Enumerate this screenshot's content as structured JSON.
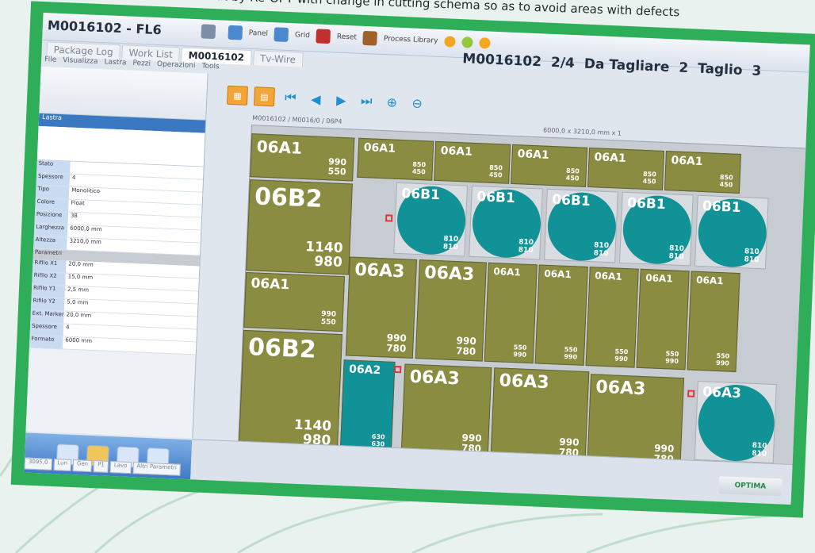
{
  "caption": "out by Re-OPT with change in cutting schema so as to avoid areas with defects",
  "app": {
    "title": "M0016102 - FL6"
  },
  "toolbar": {
    "icons": [
      {
        "name": "save-icon",
        "label": "",
        "color": "#7d8ea6"
      },
      {
        "name": "layout-icon",
        "label": "Panel",
        "color": "#4b88cf"
      },
      {
        "name": "grid-icon",
        "label": "Grid",
        "color": "#4b88cf"
      },
      {
        "name": "reset-icon",
        "label": "Reset",
        "color": "#c03030"
      },
      {
        "name": "person-icon",
        "label": "Process Library",
        "color": "#a0602a"
      }
    ],
    "lights": [
      "#f5a623",
      "#92c93a",
      "#f5a623"
    ]
  },
  "order_status": {
    "order": "M0016102",
    "sheet": "2/4",
    "to_cut_label": "Da Tagliare",
    "to_cut": "2",
    "cut_label": "Taglio",
    "cut": "3"
  },
  "tabs": [
    {
      "label": "Package Log",
      "active": false
    },
    {
      "label": "Work List",
      "active": false
    },
    {
      "label": "M0016102",
      "active": true
    },
    {
      "label": "Tv-Wire",
      "active": false
    }
  ],
  "menu": [
    "File",
    "Visualizza",
    "Lastra",
    "Pezzi",
    "Operazioni",
    "Tools"
  ],
  "left_panel": {
    "header": "Lastra",
    "props": [
      {
        "key": "Stato",
        "value": ""
      },
      {
        "key": "Spessore",
        "value": "4"
      },
      {
        "key": "Tipo",
        "value": "Monolitico"
      },
      {
        "key": "Colore",
        "value": "Float"
      },
      {
        "key": "Posizione",
        "value": "38"
      },
      {
        "key": "Larghezza",
        "value": "6000,0 mm"
      },
      {
        "key": "Altezza",
        "value": "3210,0 mm"
      }
    ],
    "section": "Parametri",
    "props2": [
      {
        "key": "Rifilo X1",
        "value": "20,0 mm"
      },
      {
        "key": "Rifilo X2",
        "value": "15,0 mm"
      },
      {
        "key": "Rifilo Y1",
        "value": "2,5 mm"
      },
      {
        "key": "Rifilo Y2",
        "value": "5,0 mm"
      },
      {
        "key": "Ext. Marker",
        "value": "20,0 mm"
      },
      {
        "key": "Spessore",
        "value": "4"
      },
      {
        "key": "Formato",
        "value": "6000 mm"
      }
    ]
  },
  "nav": {
    "buttons": [
      "first-icon",
      "prev-icon",
      "next-icon",
      "last-icon",
      "zoom-in-icon",
      "zoom-out-icon"
    ]
  },
  "canvas": {
    "header_left": "M0016102 / M0016/0 / 06P4",
    "header_mid": "6000,0 x 3210,0 mm x 1"
  },
  "pieces": [
    {
      "name": "06A1",
      "w": "990",
      "h": "550"
    },
    {
      "name": "06A1",
      "w": "850",
      "h": "450"
    },
    {
      "name": "06A1",
      "w": "850",
      "h": "450"
    },
    {
      "name": "06A1",
      "w": "850",
      "h": "450"
    },
    {
      "name": "06A1",
      "w": "850",
      "h": "450"
    },
    {
      "name": "06A1",
      "w": "850",
      "h": "450"
    },
    {
      "name": "06B2",
      "w": "1140",
      "h": "980"
    },
    {
      "name": "06B1",
      "w": "810",
      "h": "810"
    },
    {
      "name": "06B1",
      "w": "810",
      "h": "810"
    },
    {
      "name": "06B1",
      "w": "810",
      "h": "810"
    },
    {
      "name": "06B1",
      "w": "810",
      "h": "810"
    },
    {
      "name": "06B1",
      "w": "810",
      "h": "810"
    },
    {
      "name": "06A1",
      "w": "990",
      "h": "550"
    },
    {
      "name": "06A3",
      "w": "990",
      "h": "780"
    },
    {
      "name": "06A3",
      "w": "990",
      "h": "780"
    },
    {
      "name": "06A1",
      "w": "550",
      "h": "990"
    },
    {
      "name": "06A1",
      "w": "550",
      "h": "990"
    },
    {
      "name": "06A1",
      "w": "550",
      "h": "990"
    },
    {
      "name": "06A1",
      "w": "550",
      "h": "990"
    },
    {
      "name": "06A1",
      "w": "550",
      "h": "990"
    },
    {
      "name": "06B2",
      "w": "1140",
      "h": "980"
    },
    {
      "name": "06A2",
      "w": "630",
      "h": "630"
    },
    {
      "name": "06A3",
      "w": "990",
      "h": "780"
    },
    {
      "name": "06A3",
      "w": "990",
      "h": "780"
    },
    {
      "name": "06A3",
      "w": "990",
      "h": "780"
    },
    {
      "name": "06A3",
      "w": "810",
      "h": "810"
    }
  ],
  "statusbar": {
    "cells": [
      "3095,0",
      "Lun",
      "Gen",
      "P1",
      "Lavo",
      "Altri Parametri"
    ],
    "logo": "OPTIMA"
  },
  "colors": {
    "frame": "#2fae59",
    "piece": "#8a8c41",
    "circle": "#119296",
    "defect": "#e0353a"
  }
}
